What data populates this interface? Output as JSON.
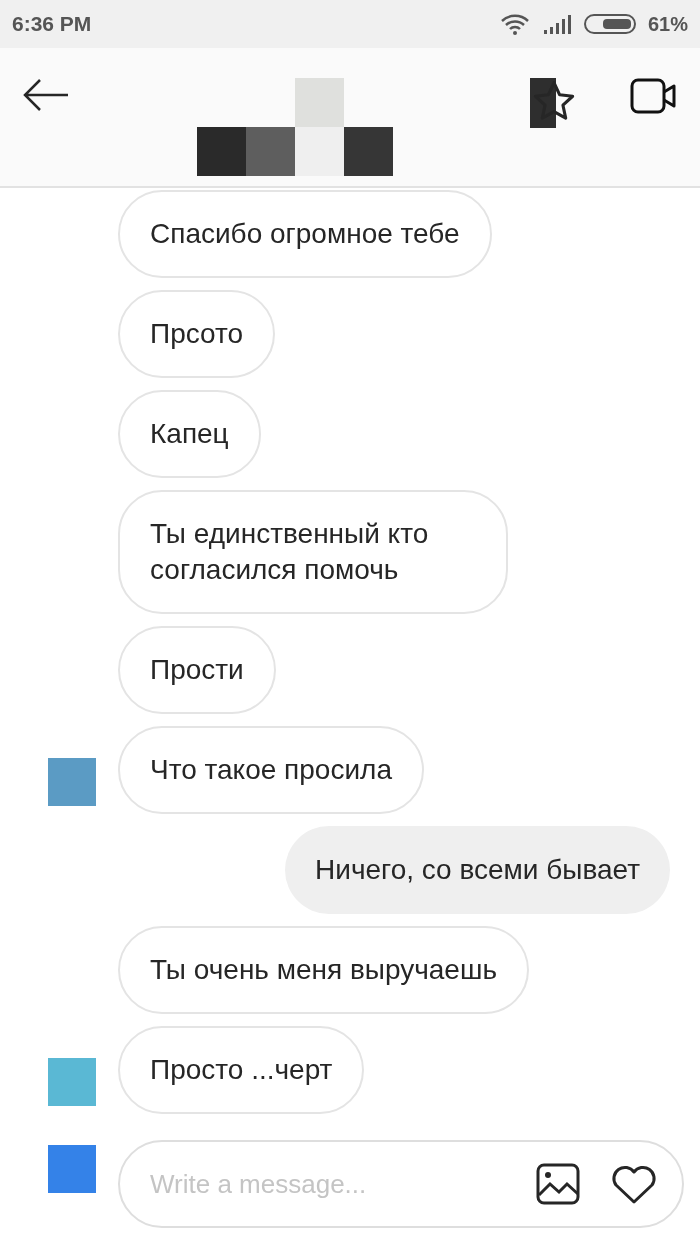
{
  "status_bar": {
    "time": "6:36 PM",
    "battery": "61%"
  },
  "messages": [
    {
      "kind": "incoming",
      "text": "Спасибо огромное тебе"
    },
    {
      "kind": "incoming",
      "text": "Прсото"
    },
    {
      "kind": "incoming",
      "text": "Капец"
    },
    {
      "kind": "incoming",
      "text": "Ты единственный кто согласился помочь"
    },
    {
      "kind": "incoming",
      "text": "Прости"
    },
    {
      "kind": "incoming",
      "text": "Что такое просила",
      "avatar": {
        "color": "#5b9bc4"
      }
    },
    {
      "kind": "outgoing",
      "text": "Ничего, со всеми бывает"
    },
    {
      "kind": "incoming",
      "text": "Ты очень меня выручаешь"
    },
    {
      "kind": "incoming",
      "text": "Просто ...черт",
      "avatar": {
        "color": "#5ab8d4"
      }
    }
  ],
  "composer": {
    "placeholder": "Write a message...",
    "avatar": {
      "color": "#3482e8"
    }
  }
}
